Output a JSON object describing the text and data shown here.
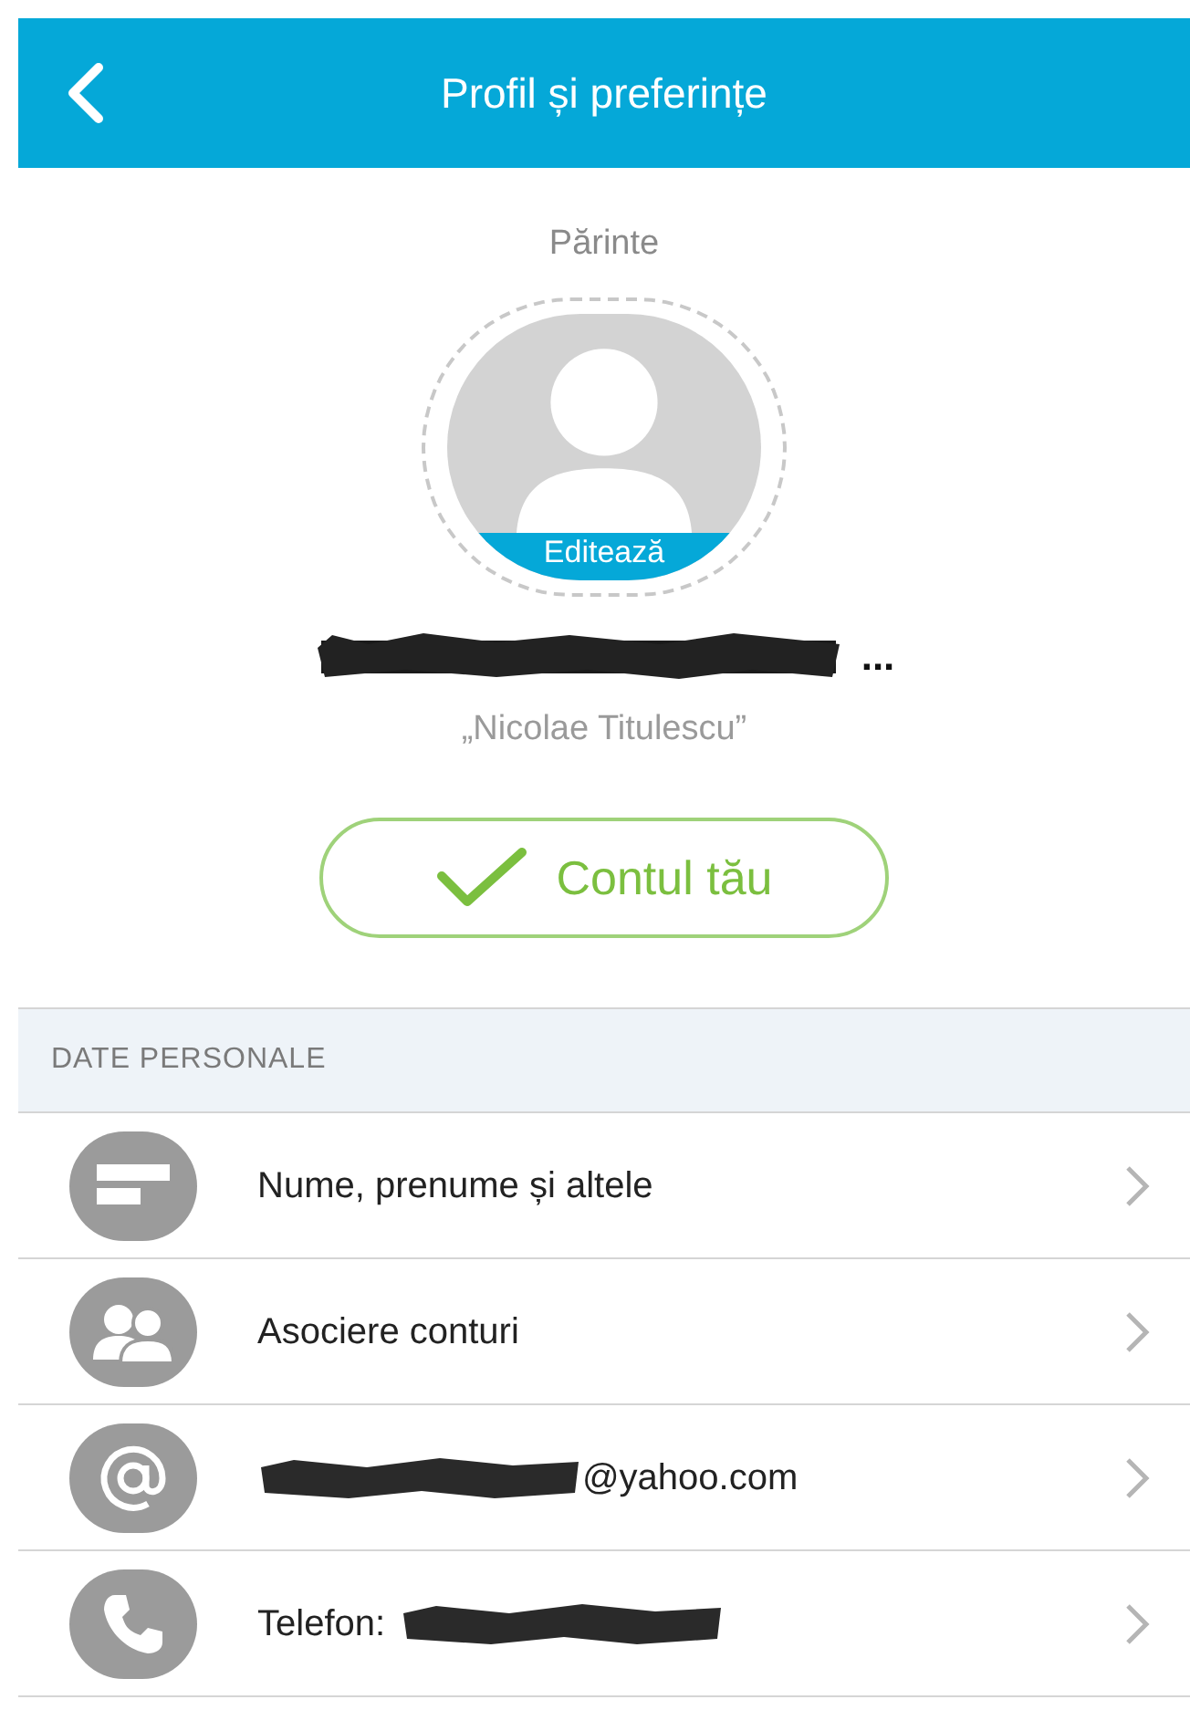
{
  "header": {
    "title": "Profil și preferințe"
  },
  "profile": {
    "role": "Părinte",
    "edit_label": "Editează",
    "name": "...",
    "school": "„Nicolae Titulescu”"
  },
  "account_button": {
    "label": "Contul tău"
  },
  "section": {
    "title": "DATE PERSONALE"
  },
  "rows": [
    {
      "kind": "card",
      "label": "Nume, prenume și altele"
    },
    {
      "kind": "people",
      "label": "Asociere conturi"
    },
    {
      "kind": "at",
      "label": "@yahoo.com"
    },
    {
      "kind": "phone",
      "label": "Telefon:"
    }
  ]
}
